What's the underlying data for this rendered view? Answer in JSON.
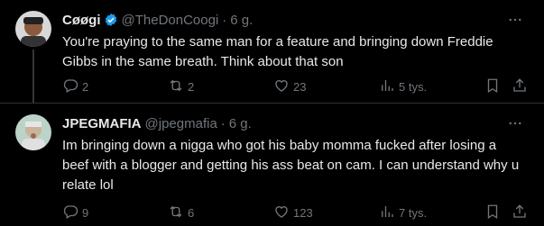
{
  "tweets": [
    {
      "name": "Cøøgi",
      "handle": "@TheDonCoogi",
      "separator": "·",
      "time": "6 g.",
      "verified": true,
      "text": "You're praying to the same man for a feature and bringing down Freddie Gibbs in the same breath. Think about that son",
      "replies": "2",
      "reposts": "2",
      "likes": "23",
      "views": "5 tys."
    },
    {
      "name": "JPEGMAFIA",
      "handle": "@jpegmafia",
      "separator": "·",
      "time": "6 g.",
      "verified": false,
      "text": "Im bringing down a nigga who got his baby momma fucked after losing a beef with a blogger and getting his ass beat on cam. I can understand why u relate lol",
      "replies": "9",
      "reposts": "6",
      "likes": "123",
      "views": "7 tys."
    }
  ],
  "colors": {
    "background": "#000000",
    "text": "#e7e9ea",
    "muted": "#71767b",
    "verified": "#1d9bf0",
    "divider": "#2f3336"
  },
  "icons": [
    "more-icon",
    "reply-icon",
    "repost-icon",
    "like-icon",
    "views-icon",
    "bookmark-icon",
    "share-icon",
    "verified-icon"
  ]
}
